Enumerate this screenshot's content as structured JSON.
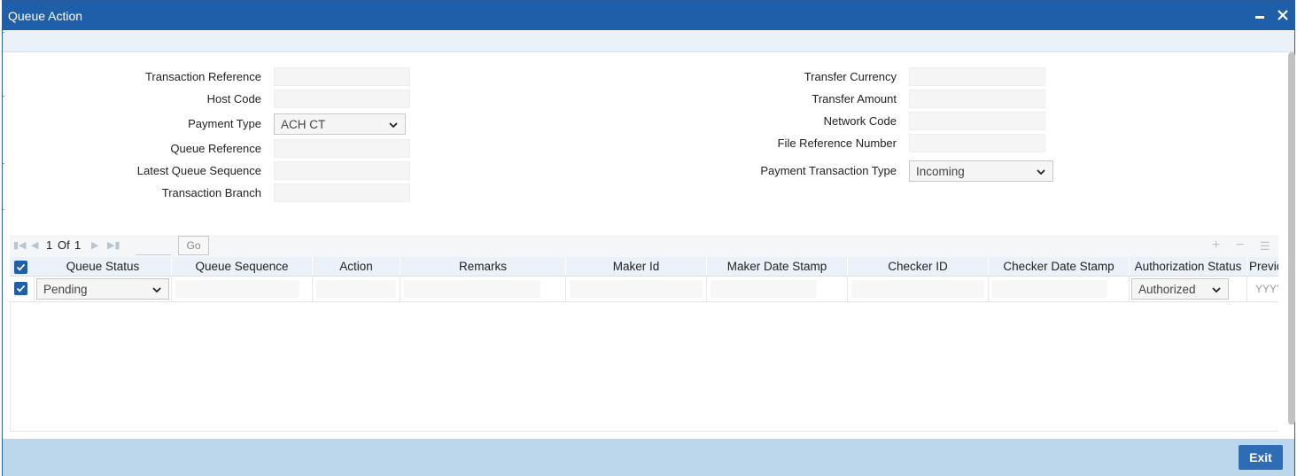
{
  "window": {
    "title": "Queue Action",
    "minimize_glyph": "▬",
    "close_glyph": "✕"
  },
  "form_left": {
    "transaction_reference_label": "Transaction Reference",
    "host_code_label": "Host Code",
    "payment_type_label": "Payment Type",
    "payment_type_value": "ACH CT",
    "queue_reference_label": "Queue Reference",
    "latest_queue_sequence_label": "Latest Queue Sequence",
    "transaction_branch_label": "Transaction Branch"
  },
  "form_right": {
    "transfer_currency_label": "Transfer Currency",
    "transfer_amount_label": "Transfer Amount",
    "network_code_label": "Network Code",
    "file_reference_number_label": "File Reference Number",
    "payment_transaction_type_label": "Payment Transaction Type",
    "payment_transaction_type_value": "Incoming"
  },
  "pager": {
    "current": "1",
    "of_label": "Of",
    "total": "1",
    "go_label": "Go"
  },
  "grid": {
    "columns": [
      "Queue Status",
      "Queue Sequence",
      "Action",
      "Remarks",
      "Maker Id",
      "Maker Date Stamp",
      "Checker ID",
      "Checker Date Stamp",
      "Authorization Status",
      "Previous"
    ],
    "rows": [
      {
        "queue_status": "Pending",
        "authorization_status": "Authorized",
        "previous_placeholder": "YYYY"
      }
    ]
  },
  "footer": {
    "exit_label": "Exit"
  },
  "colors": {
    "titlebar": "#1f5ea8",
    "footer": "#bcd6ec",
    "exit_button": "#2e6db4"
  }
}
